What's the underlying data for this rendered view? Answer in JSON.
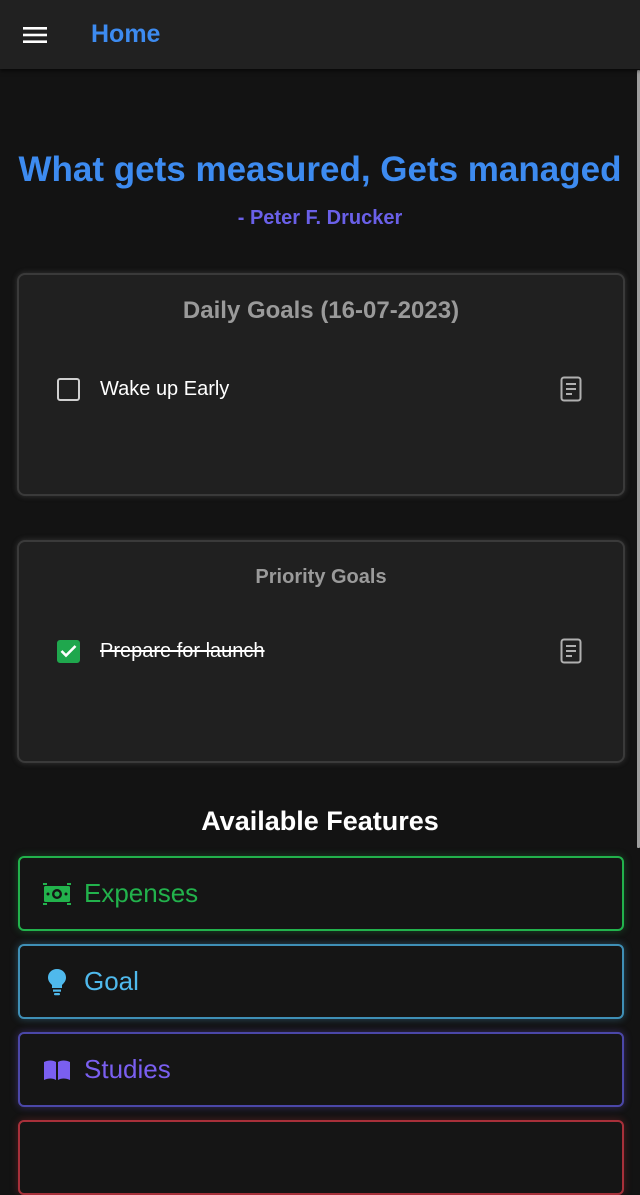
{
  "appbar": {
    "title": "Home",
    "menu_icon": "hamburger-menu-icon"
  },
  "quote": {
    "text": "What gets measured, Gets managed",
    "author": "- Peter F. Drucker"
  },
  "daily_goals": {
    "title": "Daily Goals (16-07-2023)",
    "items": [
      {
        "label": "Wake up Early",
        "checked": false
      }
    ]
  },
  "priority_goals": {
    "title": "Priority Goals",
    "items": [
      {
        "label": "Prepare for launch",
        "checked": true
      }
    ]
  },
  "features": {
    "title": "Available Features",
    "items": [
      {
        "label": "Expenses",
        "icon": "money-icon",
        "color": "#22b24c"
      },
      {
        "label": "Goal",
        "icon": "lightbulb-icon",
        "color": "#4fb9ec"
      },
      {
        "label": "Studies",
        "icon": "book-icon",
        "color": "#7a5ff0"
      },
      {
        "label": "",
        "icon": "",
        "color": "#c0303a"
      }
    ]
  },
  "colors": {
    "accent": "#3d8bf0",
    "author": "#6a60e8",
    "check": "#1fa74d"
  }
}
